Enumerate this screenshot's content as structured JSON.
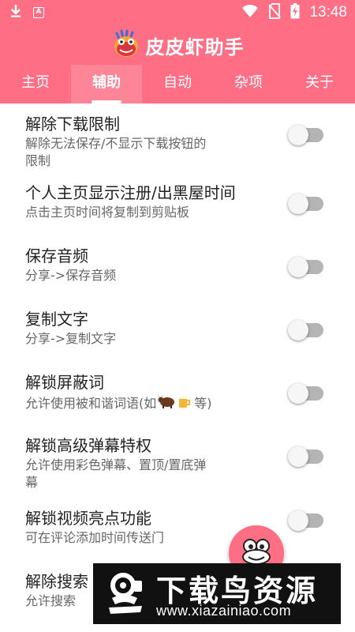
{
  "status_bar": {
    "time": "13:48",
    "icons": [
      "download-icon",
      "a-notification-icon",
      "wifi-icon",
      "no-sim-icon",
      "battery-charging-icon"
    ]
  },
  "app": {
    "title": "皮皮虾助手",
    "logo_icon": "shrimp-mascot-icon"
  },
  "tabs": [
    {
      "label": "主页",
      "active": false
    },
    {
      "label": "辅助",
      "active": true
    },
    {
      "label": "自动",
      "active": false
    },
    {
      "label": "杂项",
      "active": false
    },
    {
      "label": "关于",
      "active": false
    }
  ],
  "settings": [
    {
      "title": "解除下载限制",
      "desc": [
        "解除无法保存/不显示下载按钮的",
        "限制"
      ],
      "enabled": false
    },
    {
      "title": "个人主页显示注册/出黑屋时间",
      "desc": [
        "点击主页时间将复制到剪贴板"
      ],
      "enabled": false
    },
    {
      "title": "保存音频",
      "desc": [
        "分享->保存音频"
      ],
      "enabled": false
    },
    {
      "title": "复制文字",
      "desc": [
        "分享->复制文字"
      ],
      "enabled": false
    },
    {
      "title": "解锁屏蔽词",
      "desc": [
        "允许使用被和谐词语(如",
        "等)"
      ],
      "enabled": false
    },
    {
      "title": "解锁高级弹幕特权",
      "desc": [
        "允许使用彩色弹幕、置顶/置底弹",
        "幕"
      ],
      "enabled": false
    },
    {
      "title": "解锁视频亮点功能",
      "desc": [
        "可在评论添加时间传送门"
      ],
      "enabled": false
    },
    {
      "title": "解除搜索",
      "desc": [
        "允许搜索"
      ],
      "enabled": false
    }
  ],
  "fab": {
    "icon": "frog-face-icon"
  },
  "watermark": {
    "title": "下载鸟资源",
    "url": "www.xiazainiao.com"
  },
  "colors": {
    "primary": "#fe6f86",
    "active_tab": "#fe8498",
    "toggle_track": "#b4b4b4",
    "toggle_knob": "#f6f6f6"
  }
}
